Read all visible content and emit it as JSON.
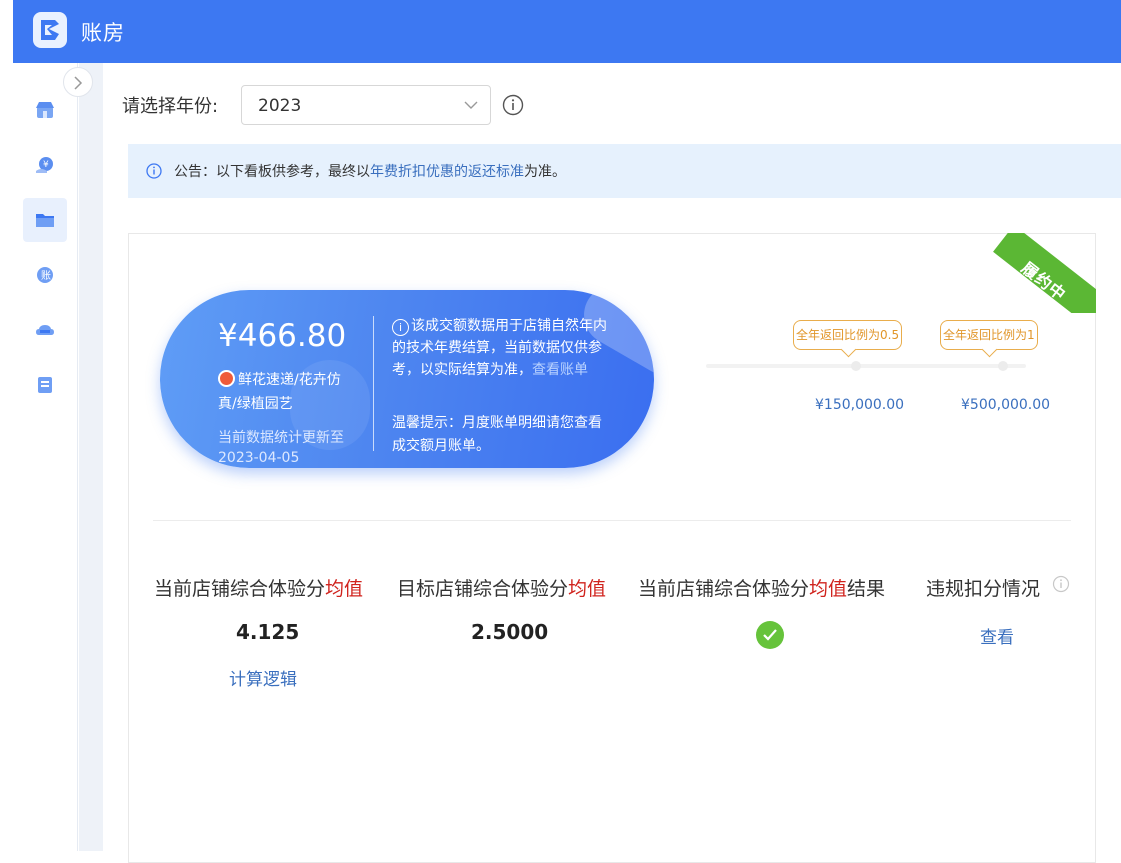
{
  "app": {
    "title": "账房"
  },
  "filter": {
    "label": "请选择年份:",
    "year": "2023"
  },
  "notice": {
    "prefix": "公告：以下看板供参考，最终以",
    "link": "年费折扣优惠的返还标准",
    "suffix": "为准。"
  },
  "status_ribbon": "履约中",
  "summary": {
    "amount": "¥466.80",
    "shop_name": "鲜花速递/花卉仿真/绿植园艺",
    "updated_label": "当前数据统计更新至",
    "updated_date": "2023-04-05",
    "info_text": "该成交额数据用于店铺自然年内的技术年费结算，当前数据仅供参考，以实际结算为准，",
    "info_link": "查看账单",
    "tip": "温馨提示：月度账单明细请您查看成交额月账单。"
  },
  "tiers": [
    {
      "label": "全年返回比例为0.5",
      "amount": "¥150,000.00"
    },
    {
      "label": "全年返回比例为1",
      "amount": "¥500,000.00"
    }
  ],
  "metrics": [
    {
      "title_pre": "当前店铺综合体验分",
      "title_hl": "均值",
      "title_post": "",
      "value": "4.125",
      "link": "计算逻辑"
    },
    {
      "title_pre": "目标店铺综合体验分",
      "title_hl": "均值",
      "title_post": "",
      "value": "2.5000"
    },
    {
      "title_pre": "当前店铺综合体验分",
      "title_hl": "均值",
      "title_post": "结果",
      "status": "pass"
    },
    {
      "title_pre": "违规扣分情况",
      "title_hl": "",
      "title_post": "",
      "link": "查看"
    }
  ],
  "colors": {
    "header": "#3d78f2",
    "accent_link": "#3a6fbe",
    "highlight": "#d0231d",
    "success": "#66c33b",
    "tier": "#e1962a",
    "ribbon": "#5bb734"
  }
}
